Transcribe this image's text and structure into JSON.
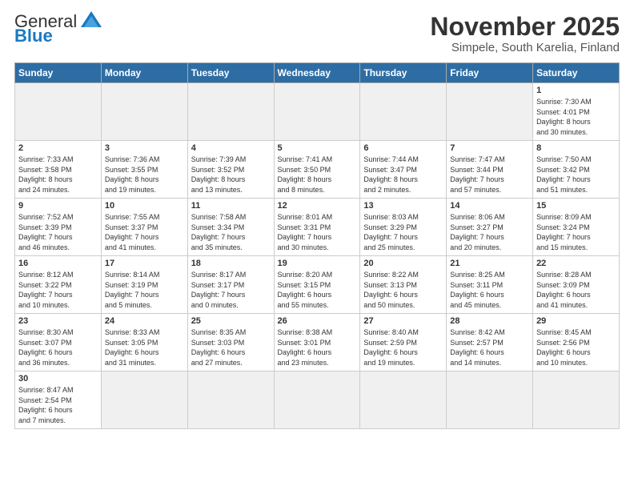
{
  "header": {
    "logo_general": "General",
    "logo_blue": "Blue",
    "title": "November 2025",
    "subtitle": "Simpele, South Karelia, Finland"
  },
  "weekdays": [
    "Sunday",
    "Monday",
    "Tuesday",
    "Wednesday",
    "Thursday",
    "Friday",
    "Saturday"
  ],
  "weeks": [
    [
      {
        "day": "",
        "info": "",
        "empty": true
      },
      {
        "day": "",
        "info": "",
        "empty": true
      },
      {
        "day": "",
        "info": "",
        "empty": true
      },
      {
        "day": "",
        "info": "",
        "empty": true
      },
      {
        "day": "",
        "info": "",
        "empty": true
      },
      {
        "day": "",
        "info": "",
        "empty": true
      },
      {
        "day": "1",
        "info": "Sunrise: 7:30 AM\nSunset: 4:01 PM\nDaylight: 8 hours\nand 30 minutes."
      }
    ],
    [
      {
        "day": "2",
        "info": "Sunrise: 7:33 AM\nSunset: 3:58 PM\nDaylight: 8 hours\nand 24 minutes."
      },
      {
        "day": "3",
        "info": "Sunrise: 7:36 AM\nSunset: 3:55 PM\nDaylight: 8 hours\nand 19 minutes."
      },
      {
        "day": "4",
        "info": "Sunrise: 7:39 AM\nSunset: 3:52 PM\nDaylight: 8 hours\nand 13 minutes."
      },
      {
        "day": "5",
        "info": "Sunrise: 7:41 AM\nSunset: 3:50 PM\nDaylight: 8 hours\nand 8 minutes."
      },
      {
        "day": "6",
        "info": "Sunrise: 7:44 AM\nSunset: 3:47 PM\nDaylight: 8 hours\nand 2 minutes."
      },
      {
        "day": "7",
        "info": "Sunrise: 7:47 AM\nSunset: 3:44 PM\nDaylight: 7 hours\nand 57 minutes."
      },
      {
        "day": "8",
        "info": "Sunrise: 7:50 AM\nSunset: 3:42 PM\nDaylight: 7 hours\nand 51 minutes."
      }
    ],
    [
      {
        "day": "9",
        "info": "Sunrise: 7:52 AM\nSunset: 3:39 PM\nDaylight: 7 hours\nand 46 minutes."
      },
      {
        "day": "10",
        "info": "Sunrise: 7:55 AM\nSunset: 3:37 PM\nDaylight: 7 hours\nand 41 minutes."
      },
      {
        "day": "11",
        "info": "Sunrise: 7:58 AM\nSunset: 3:34 PM\nDaylight: 7 hours\nand 35 minutes."
      },
      {
        "day": "12",
        "info": "Sunrise: 8:01 AM\nSunset: 3:31 PM\nDaylight: 7 hours\nand 30 minutes."
      },
      {
        "day": "13",
        "info": "Sunrise: 8:03 AM\nSunset: 3:29 PM\nDaylight: 7 hours\nand 25 minutes."
      },
      {
        "day": "14",
        "info": "Sunrise: 8:06 AM\nSunset: 3:27 PM\nDaylight: 7 hours\nand 20 minutes."
      },
      {
        "day": "15",
        "info": "Sunrise: 8:09 AM\nSunset: 3:24 PM\nDaylight: 7 hours\nand 15 minutes."
      }
    ],
    [
      {
        "day": "16",
        "info": "Sunrise: 8:12 AM\nSunset: 3:22 PM\nDaylight: 7 hours\nand 10 minutes."
      },
      {
        "day": "17",
        "info": "Sunrise: 8:14 AM\nSunset: 3:19 PM\nDaylight: 7 hours\nand 5 minutes."
      },
      {
        "day": "18",
        "info": "Sunrise: 8:17 AM\nSunset: 3:17 PM\nDaylight: 7 hours\nand 0 minutes."
      },
      {
        "day": "19",
        "info": "Sunrise: 8:20 AM\nSunset: 3:15 PM\nDaylight: 6 hours\nand 55 minutes."
      },
      {
        "day": "20",
        "info": "Sunrise: 8:22 AM\nSunset: 3:13 PM\nDaylight: 6 hours\nand 50 minutes."
      },
      {
        "day": "21",
        "info": "Sunrise: 8:25 AM\nSunset: 3:11 PM\nDaylight: 6 hours\nand 45 minutes."
      },
      {
        "day": "22",
        "info": "Sunrise: 8:28 AM\nSunset: 3:09 PM\nDaylight: 6 hours\nand 41 minutes."
      }
    ],
    [
      {
        "day": "23",
        "info": "Sunrise: 8:30 AM\nSunset: 3:07 PM\nDaylight: 6 hours\nand 36 minutes."
      },
      {
        "day": "24",
        "info": "Sunrise: 8:33 AM\nSunset: 3:05 PM\nDaylight: 6 hours\nand 31 minutes."
      },
      {
        "day": "25",
        "info": "Sunrise: 8:35 AM\nSunset: 3:03 PM\nDaylight: 6 hours\nand 27 minutes."
      },
      {
        "day": "26",
        "info": "Sunrise: 8:38 AM\nSunset: 3:01 PM\nDaylight: 6 hours\nand 23 minutes."
      },
      {
        "day": "27",
        "info": "Sunrise: 8:40 AM\nSunset: 2:59 PM\nDaylight: 6 hours\nand 19 minutes."
      },
      {
        "day": "28",
        "info": "Sunrise: 8:42 AM\nSunset: 2:57 PM\nDaylight: 6 hours\nand 14 minutes."
      },
      {
        "day": "29",
        "info": "Sunrise: 8:45 AM\nSunset: 2:56 PM\nDaylight: 6 hours\nand 10 minutes."
      }
    ],
    [
      {
        "day": "30",
        "info": "Sunrise: 8:47 AM\nSunset: 2:54 PM\nDaylight: 6 hours\nand 7 minutes.",
        "last": true
      },
      {
        "day": "",
        "info": "",
        "empty": true,
        "last": true
      },
      {
        "day": "",
        "info": "",
        "empty": true,
        "last": true
      },
      {
        "day": "",
        "info": "",
        "empty": true,
        "last": true
      },
      {
        "day": "",
        "info": "",
        "empty": true,
        "last": true
      },
      {
        "day": "",
        "info": "",
        "empty": true,
        "last": true
      },
      {
        "day": "",
        "info": "",
        "empty": true,
        "last": true
      }
    ]
  ]
}
